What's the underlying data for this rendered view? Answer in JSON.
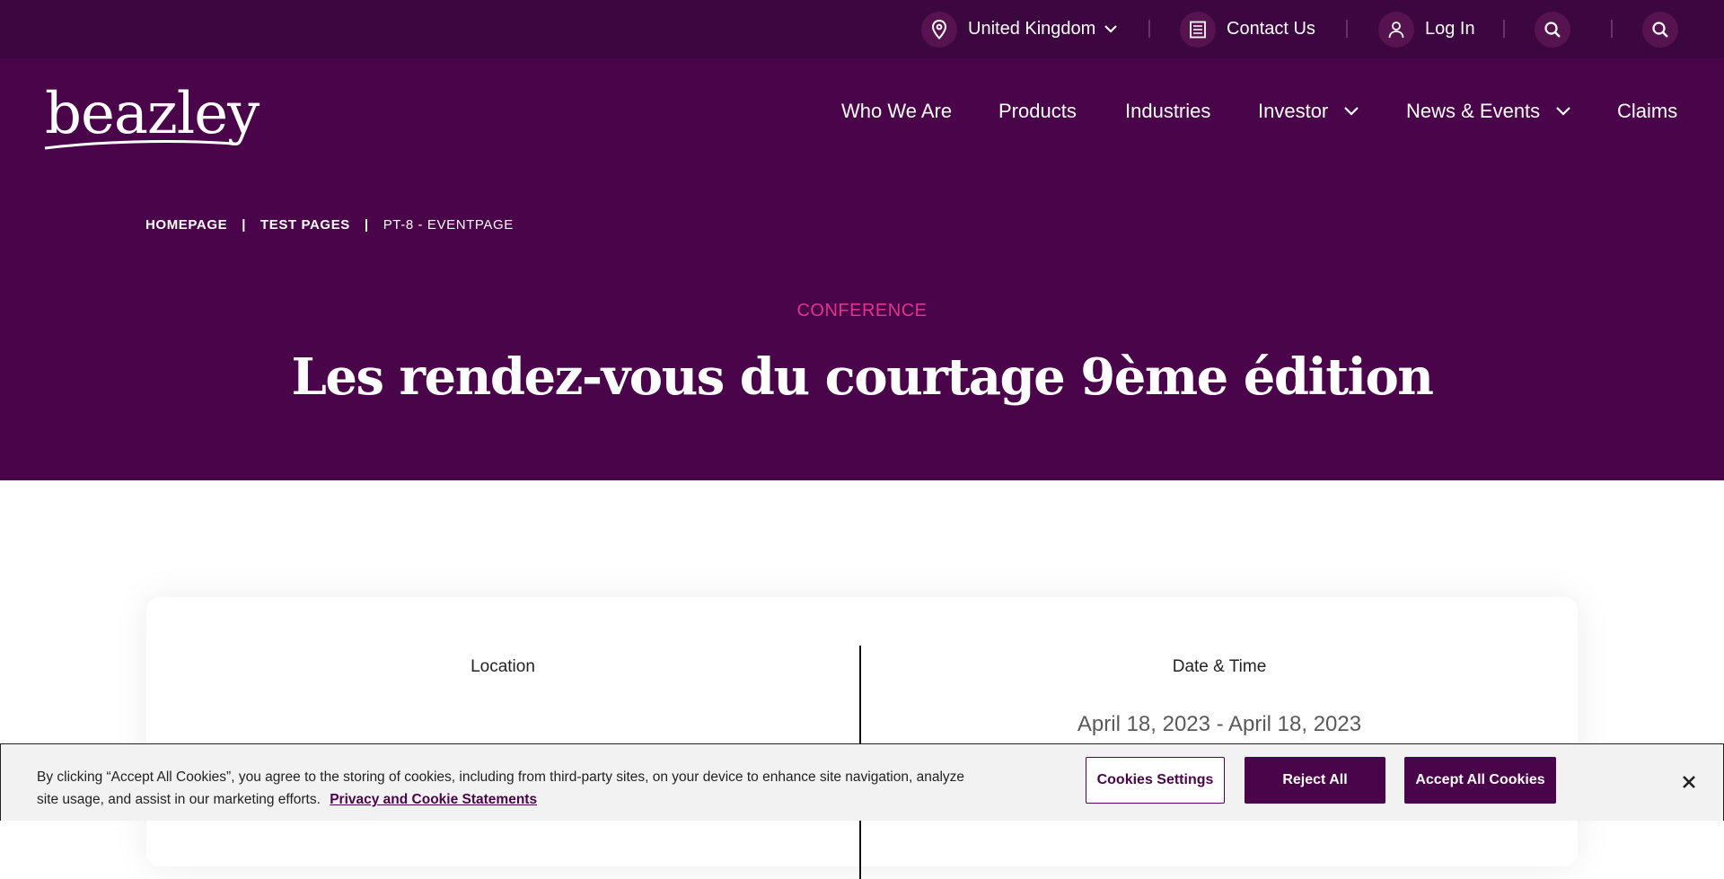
{
  "utility_bar": {
    "region": "United Kingdom",
    "contact": "Contact Us",
    "login": "Log In"
  },
  "header": {
    "logo": "beazley",
    "nav": [
      "Who We Are",
      "Products",
      "Industries",
      "Investor",
      "News & Events",
      "Claims"
    ]
  },
  "breadcrumb": {
    "home": "HOMEPAGE",
    "section": "TEST PAGES",
    "current": "PT-8 - EVENTPAGE",
    "separator": "|"
  },
  "event": {
    "type": "CONFERENCE",
    "title": "Les rendez-vous du courtage 9ème édition",
    "location_label": "Location",
    "datetime_label": "Date & Time",
    "date_range": "April 18, 2023 - April 18, 2023"
  },
  "cookie_banner": {
    "text": "By clicking “Accept All Cookies”, you agree to the storing of cookies, including from third-party sites, on your device to enhance site navigation, analyze site usage, and assist in our marketing efforts.",
    "link": "Privacy and Cookie Statements",
    "settings_label": "Cookies Settings",
    "reject_label": "Reject All",
    "accept_label": "Accept All Cookies"
  },
  "colors": {
    "utility_bg": "#3c0640",
    "header_bg": "#4a044a",
    "accent_pink": "#e0338e",
    "button_purple": "#4a044a"
  },
  "icons": [
    "location-pin-icon",
    "chevron-down-icon",
    "contact-list-icon",
    "user-icon",
    "search-icon",
    "close-icon"
  ]
}
